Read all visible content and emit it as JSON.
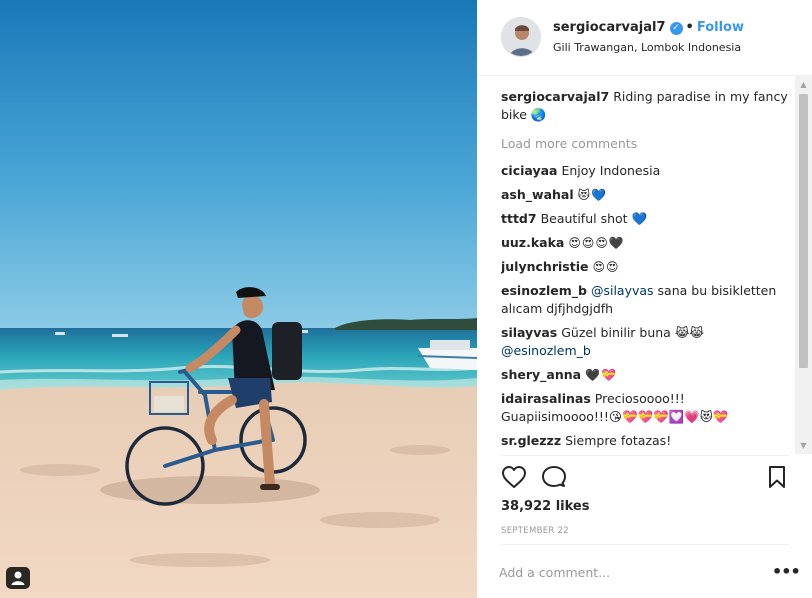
{
  "post": {
    "username": "sergiocarvajal7",
    "follow_label": "Follow",
    "location": "Gili Trawangan, Lombok Indonesia",
    "caption_user": "sergiocarvajal7",
    "caption_text": "Riding paradise in my fancy bike 🌏",
    "load_more": "Load more comments",
    "likes": "38,922 likes",
    "date": "SEPTEMBER 22",
    "add_comment_placeholder": "Add a comment...",
    "more_options": "•••"
  },
  "comments": [
    {
      "user": "ciciayaa",
      "text": "Enjoy Indonesia"
    },
    {
      "user": "ash_wahal",
      "text": "😻💙"
    },
    {
      "user": "tttd7",
      "text": "Beautiful shot 💙"
    },
    {
      "user": "uuz.kaka",
      "text": "😍😍😍🖤"
    },
    {
      "user": "julynchristie",
      "text": "😍😍"
    },
    {
      "user": "esinozlem_b",
      "mention": "@silayvas",
      "text": "sana bu bisikletten alıcam djfjhdgjdfh"
    },
    {
      "user": "silayvas",
      "text": "Güzel binilir buna 😹😹",
      "mention_after": "@esinozlem_b"
    },
    {
      "user": "shery_anna",
      "text": "🖤💝"
    },
    {
      "user": "idairasalinas",
      "text": "Preciosoooo!!! Guapiisimoooo!!!😘💝💝💝💟💗😻💝"
    },
    {
      "user": "sr.glezzz",
      "text": "Siempre fotazas!"
    }
  ],
  "icons": {
    "heart": "heart-icon",
    "comment": "comment-bubble-icon",
    "save": "bookmark-icon",
    "verified": "verified-badge-icon",
    "tag": "user-tag-icon"
  },
  "colors": {
    "accent": "#3897f0",
    "text": "#262626",
    "muted": "#999999"
  }
}
